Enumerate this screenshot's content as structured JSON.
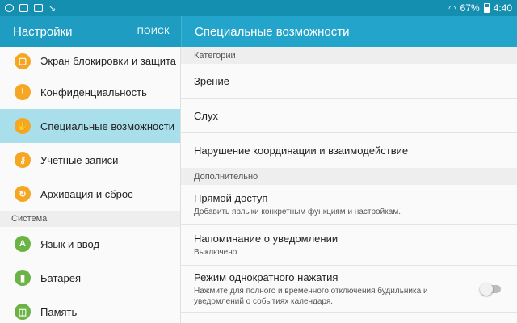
{
  "status_bar": {
    "battery": "67%",
    "time": "4:40"
  },
  "app_bar": {
    "title": "Настройки",
    "search": "ПОИСК",
    "detail_title": "Специальные возможности"
  },
  "sidebar": {
    "items_top": [
      {
        "label": "Экран блокировки и защита",
        "icon": "lock-icon",
        "color": "#f5a623"
      },
      {
        "label": "Конфиденциальность",
        "icon": "privacy-icon",
        "color": "#f5a623"
      },
      {
        "label": "Специальные возможности",
        "icon": "hand-icon",
        "color": "#f5a623"
      },
      {
        "label": "Учетные записи",
        "icon": "key-icon",
        "color": "#f5a623"
      },
      {
        "label": "Архивация и сброс",
        "icon": "backup-icon",
        "color": "#f5a623"
      }
    ],
    "section_system": "Система",
    "items_system": [
      {
        "label": "Язык и ввод",
        "icon": "language-icon",
        "color": "#6ab344"
      },
      {
        "label": "Батарея",
        "icon": "battery-icon",
        "color": "#6ab344"
      },
      {
        "label": "Память",
        "icon": "storage-icon",
        "color": "#6ab344"
      }
    ]
  },
  "detail": {
    "section_categories": "Категории",
    "categories": [
      "Зрение",
      "Слух",
      "Нарушение координации и взаимодействие"
    ],
    "section_more": "Дополнительно",
    "direct_access": {
      "title": "Прямой доступ",
      "sub": "Добавить ярлыки конкретным функциям и настройкам."
    },
    "notification_reminder": {
      "title": "Напоминание о уведомлении",
      "sub": "Выключено"
    },
    "single_tap": {
      "title": "Режим однократного нажатия",
      "sub": "Нажмите для полного и временного отключения будильника и уведомлений о событиях календаря."
    }
  }
}
